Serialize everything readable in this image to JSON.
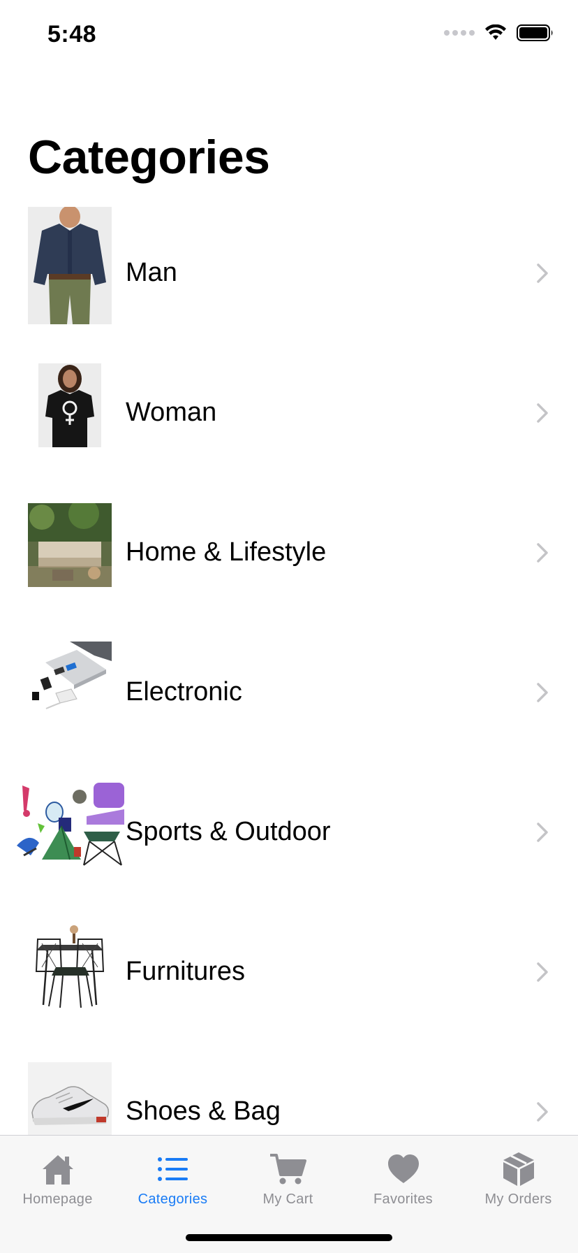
{
  "status_bar": {
    "time": "5:48"
  },
  "page": {
    "title": "Categories"
  },
  "categories": [
    {
      "label": "Man",
      "thumb_icon": "man-shirt-photo"
    },
    {
      "label": "Woman",
      "thumb_icon": "woman-tshirt-photo"
    },
    {
      "label": "Home & Lifestyle",
      "thumb_icon": "patio-lounge-photo"
    },
    {
      "label": "Electronic",
      "thumb_icon": "usb-hub-photo"
    },
    {
      "label": "Sports & Outdoor",
      "thumb_icon": "sports-gear-photo"
    },
    {
      "label": "Furnitures",
      "thumb_icon": "table-chairs-photo"
    },
    {
      "label": "Shoes & Bag",
      "thumb_icon": "sneaker-photo"
    }
  ],
  "tabbar": {
    "active": "Categories",
    "tabs": [
      {
        "label": "Homepage",
        "icon": "home-icon"
      },
      {
        "label": "Categories",
        "icon": "list-icon"
      },
      {
        "label": "My Cart",
        "icon": "cart-icon"
      },
      {
        "label": "Favorites",
        "icon": "heart-icon"
      },
      {
        "label": "My Orders",
        "icon": "box-icon"
      }
    ]
  },
  "colors": {
    "accent": "#1a7cf5",
    "inactive": "#8e8e93",
    "chevron": "#c4c4c7"
  }
}
